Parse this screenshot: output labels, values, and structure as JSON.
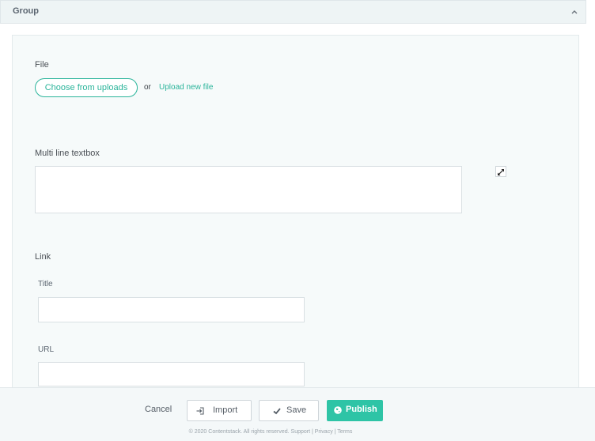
{
  "group": {
    "title": "Group",
    "collapse_icon": "chevron-up-icon"
  },
  "file": {
    "label": "File",
    "choose_label": "Choose from uploads",
    "or_text": "or",
    "upload_label": "Upload new file"
  },
  "multiline": {
    "label": "Multi line textbox",
    "value": "",
    "expand_icon": "expand-icon"
  },
  "link": {
    "label": "Link",
    "title_label": "Title",
    "title_value": "",
    "url_label": "URL",
    "url_value": ""
  },
  "footer": {
    "cancel_label": "Cancel",
    "import_label": "Import",
    "save_label": "Save",
    "publish_label": "Publish",
    "copyright": "© 2020 Contentstack. All rights reserved. Support | Privacy | Terms"
  },
  "colors": {
    "accent": "#2ab49a",
    "publish": "#2ec4a6"
  }
}
